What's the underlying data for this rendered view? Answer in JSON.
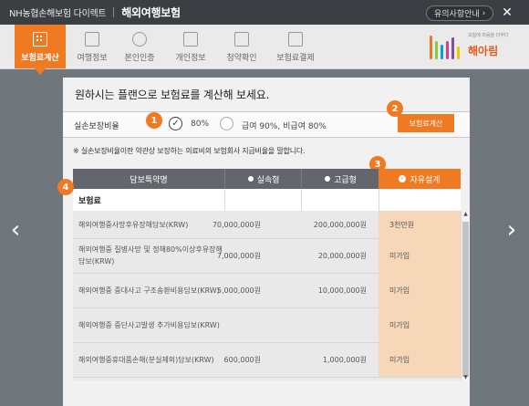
{
  "topbar": {
    "brand": "NH농협손해보험 다이렉트",
    "title": "해외여행보험",
    "notice": "유의사항안내",
    "notice_arrow": "›",
    "close": "✕"
  },
  "nav": {
    "items": [
      {
        "label": "보험료계산",
        "icon": "calculator-icon",
        "active": true
      },
      {
        "label": "여행정보",
        "icon": "map-icon",
        "active": false
      },
      {
        "label": "본인인증",
        "icon": "person-icon",
        "active": false
      },
      {
        "label": "개인정보",
        "icon": "edit-icon",
        "active": false
      },
      {
        "label": "청약확인",
        "icon": "checkbox-icon",
        "active": false
      },
      {
        "label": "보험료결제",
        "icon": "monitor-icon",
        "active": false
      }
    ]
  },
  "logo": {
    "tagline": "보험에 마음을 더하다",
    "name": "해아림",
    "colors": [
      "#ef7a22",
      "#8dc63f",
      "#00a0e9",
      "#e8388a",
      "#7f4fa0",
      "#f4c300"
    ]
  },
  "panel": {
    "heading": "원하시는 플랜으로 보험료를 계산해 보세요.",
    "ratio_label": "실손보장비율",
    "option1": "80%",
    "option2": "급여 90%, 비급여 80%",
    "calc_button": "보험료계산",
    "note": "※ 실손보장비율이란 약관상 보장하는 의료비의 보험회사 지급비율을 말합니다.",
    "badges": [
      "1",
      "2",
      "3",
      "4"
    ]
  },
  "table": {
    "headers": {
      "name": "담보특약명",
      "basic": "실속형",
      "premium": "고급형",
      "custom": "자유설계"
    },
    "subhead_label": "보험료",
    "rows": [
      {
        "name": "해외여행중사망후유장해담보(KRW)",
        "basic": "70,000,000원",
        "premium": "200,000,000원",
        "custom": "3천만원"
      },
      {
        "name": "해외여행중 질병사망 및 정해80%이상후유장해담보(KRW)",
        "basic": "7,000,000원",
        "premium": "20,000,000원",
        "custom": "미가입"
      },
      {
        "name": "해외여행중 중대사고 구조송환비용담보(KRW)",
        "basic": "5,000,000원",
        "premium": "10,000,000원",
        "custom": "미가입"
      },
      {
        "name": "해외여행중 중단사고발생 추가비용담보(KRW)",
        "basic": "",
        "premium": "",
        "custom": "미가입"
      },
      {
        "name": "해외여행중휴대품손해(분실제외)담보(KRW)",
        "basic": "600,000원",
        "premium": "1,000,000원",
        "custom": "미가입"
      }
    ]
  },
  "arrows": {
    "left": "‹",
    "right": "›"
  }
}
